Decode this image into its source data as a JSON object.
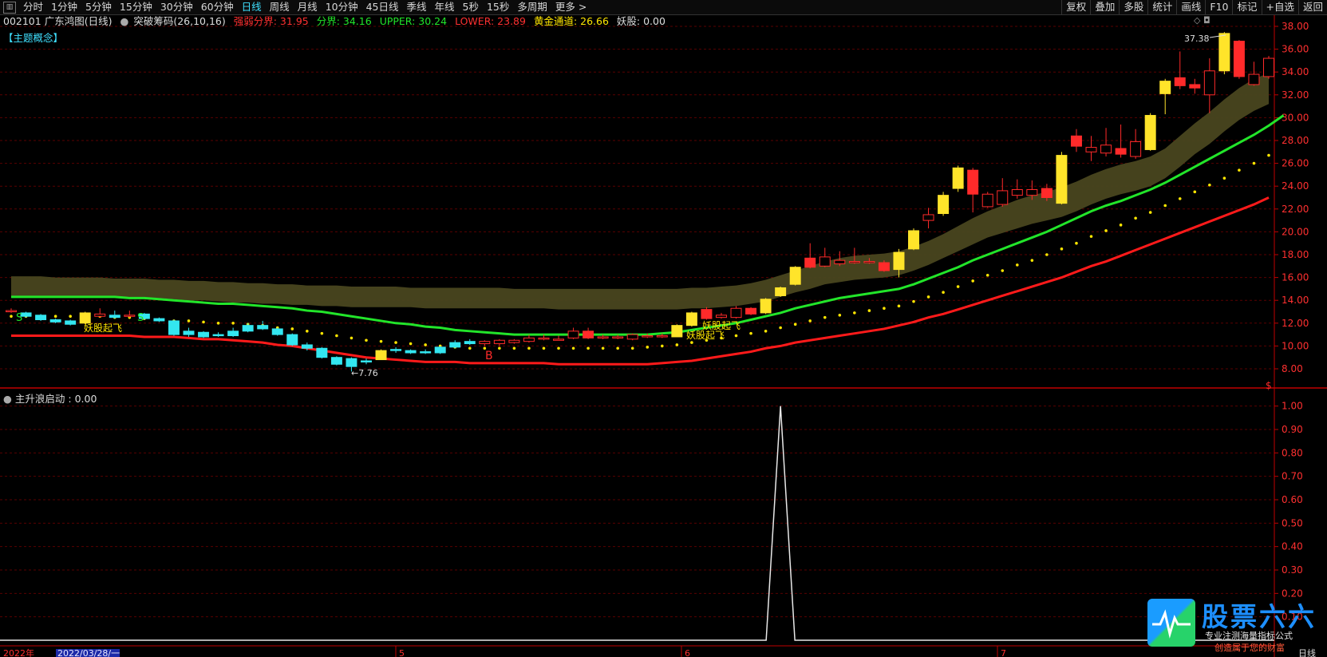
{
  "toolbar": {
    "menu_icon": "menu-icon",
    "periods": [
      "分时",
      "1分钟",
      "5分钟",
      "15分钟",
      "30分钟",
      "60分钟",
      "日线",
      "周线",
      "月线",
      "10分钟",
      "45日线",
      "季线",
      "年线",
      "5秒",
      "15秒",
      "多周期",
      "更多 >"
    ],
    "active_period": "日线",
    "right_buttons": [
      "复权",
      "叠加",
      "多股",
      "统计",
      "画线",
      "F10",
      "标记",
      "+自选",
      "返回"
    ]
  },
  "info": {
    "code_name": "002101 广东鸿图(日线)",
    "indicator": "突破筹码(26,10,16)",
    "qr_label": "强弱分界: 31.95",
    "fj_label": "分界: 34.16",
    "upper_label": "UPPER: 30.24",
    "lower_label": "LOWER: 23.89",
    "gold_label": "黄金通道: 26.66",
    "yao_label": "妖股: 0.00",
    "topic_tag": "【主题概念】",
    "icons": "◇ ◘"
  },
  "annotations": {
    "yao1": "妖股起飞",
    "yao2": "妖股起飞",
    "yao3": "妖股起飞",
    "low_label": "←7.76",
    "high_label": "37.38",
    "b_marker": "B",
    "s_marker1": "S",
    "s_marker2": "S",
    "s_marker3": "$"
  },
  "indicator_panel": {
    "title": "主升浪启动 : 0.00"
  },
  "axis": {
    "price_ticks": [
      "38.00",
      "36.00",
      "34.00",
      "32.00",
      "30.00",
      "28.00",
      "26.00",
      "24.00",
      "22.00",
      "20.00",
      "18.00",
      "16.00",
      "14.00",
      "12.00",
      "10.00",
      "8.00"
    ],
    "ind_ticks": [
      "1.00",
      "0.90",
      "0.80",
      "0.70",
      "0.60",
      "0.50",
      "0.40",
      "0.30",
      "0.20",
      "0.10"
    ],
    "dates": [
      "2022年",
      "2022/03/28/一",
      "5",
      "6",
      "7"
    ],
    "period_label": "日线"
  },
  "logo": {
    "title": "股票六六",
    "sub1": "专业注测海量指标公式",
    "sub2": "创造属于您的财富"
  },
  "colors": {
    "up": "#ff2a2a",
    "down": "#33e6f0",
    "yellow_candle": "#ffe42a",
    "green_line": "#22e52a",
    "red_line": "#ff1a1a",
    "band": "#49461f",
    "dots": "#ffe600",
    "grid": "#5a0000",
    "axis": "#c00000"
  },
  "chart_data": {
    "type": "candlestick",
    "price_range": [
      7,
      38.5
    ],
    "candles": [
      [
        13.1,
        13.0,
        13.3,
        12.9,
        "up"
      ],
      [
        12.9,
        12.6,
        13.0,
        12.5,
        "down"
      ],
      [
        12.7,
        12.3,
        12.8,
        12.2,
        "down"
      ],
      [
        12.3,
        12.1,
        12.4,
        12.0,
        "down"
      ],
      [
        12.2,
        11.9,
        12.3,
        11.8,
        "down"
      ],
      [
        12.0,
        12.9,
        13.0,
        11.9,
        "yellow"
      ],
      [
        12.8,
        12.6,
        13.3,
        12.5,
        "up"
      ],
      [
        12.7,
        12.5,
        13.1,
        12.4,
        "down"
      ],
      [
        12.6,
        12.7,
        13.1,
        12.5,
        "up"
      ],
      [
        12.8,
        12.4,
        12.9,
        12.3,
        "down"
      ],
      [
        12.4,
        12.2,
        12.5,
        12.1,
        "down"
      ],
      [
        12.2,
        11.0,
        12.3,
        10.9,
        "down"
      ],
      [
        11.0,
        11.3,
        11.6,
        10.8,
        "down"
      ],
      [
        11.2,
        10.8,
        11.3,
        10.7,
        "down"
      ],
      [
        11.0,
        11.0,
        11.2,
        10.8,
        "down"
      ],
      [
        10.9,
        11.3,
        11.6,
        10.8,
        "down"
      ],
      [
        11.3,
        11.8,
        12.0,
        11.2,
        "down"
      ],
      [
        11.8,
        11.5,
        12.2,
        11.4,
        "down"
      ],
      [
        11.5,
        11.0,
        11.6,
        10.9,
        "down"
      ],
      [
        11.0,
        10.1,
        11.1,
        10.0,
        "down"
      ],
      [
        10.1,
        9.8,
        10.3,
        9.6,
        "down"
      ],
      [
        9.8,
        9.0,
        9.9,
        8.9,
        "down"
      ],
      [
        9.0,
        8.4,
        9.1,
        8.3,
        "down"
      ],
      [
        8.2,
        8.9,
        9.0,
        7.76,
        "down"
      ],
      [
        8.7,
        8.6,
        8.9,
        8.4,
        "down"
      ],
      [
        8.8,
        9.6,
        9.7,
        8.8,
        "yellow"
      ],
      [
        9.6,
        9.7,
        9.9,
        9.4,
        "down"
      ],
      [
        9.6,
        9.4,
        9.7,
        9.3,
        "down"
      ],
      [
        9.5,
        9.4,
        9.7,
        9.3,
        "down"
      ],
      [
        9.4,
        9.9,
        10.0,
        9.3,
        "down"
      ],
      [
        9.9,
        10.3,
        10.5,
        9.8,
        "down"
      ],
      [
        10.2,
        10.4,
        10.6,
        10.1,
        "down"
      ],
      [
        10.4,
        10.2,
        10.5,
        10.0,
        "up"
      ],
      [
        10.2,
        10.5,
        10.6,
        10.0,
        "up"
      ],
      [
        10.5,
        10.3,
        10.6,
        10.2,
        "up"
      ],
      [
        10.4,
        10.7,
        11.0,
        10.3,
        "up"
      ],
      [
        10.7,
        10.6,
        11.0,
        10.5,
        "up"
      ],
      [
        10.6,
        10.6,
        10.9,
        10.5,
        "up"
      ],
      [
        10.7,
        11.3,
        11.6,
        10.6,
        "up"
      ],
      [
        11.3,
        10.7,
        11.6,
        10.6,
        "red"
      ],
      [
        10.8,
        10.8,
        11.0,
        10.6,
        "up"
      ],
      [
        10.8,
        10.7,
        11.0,
        10.6,
        "up"
      ],
      [
        10.6,
        11.0,
        11.1,
        10.5,
        "up"
      ],
      [
        10.9,
        10.9,
        11.1,
        10.7,
        "up"
      ],
      [
        10.9,
        10.8,
        11.1,
        10.7,
        "up"
      ],
      [
        10.8,
        11.8,
        11.9,
        10.8,
        "yellow"
      ],
      [
        11.8,
        12.9,
        13.0,
        11.7,
        "yellow"
      ],
      [
        13.2,
        12.4,
        13.4,
        12.3,
        "red"
      ],
      [
        12.5,
        12.7,
        12.9,
        12.4,
        "up"
      ],
      [
        12.5,
        13.3,
        13.5,
        12.4,
        "up"
      ],
      [
        13.3,
        12.8,
        13.4,
        12.7,
        "red"
      ],
      [
        12.9,
        14.1,
        14.2,
        12.8,
        "yellow"
      ],
      [
        14.4,
        15.1,
        15.2,
        14.3,
        "yellow"
      ],
      [
        15.4,
        16.9,
        17.0,
        15.3,
        "yellow"
      ],
      [
        17.7,
        16.9,
        19.0,
        16.8,
        "red"
      ],
      [
        17.0,
        17.8,
        18.6,
        16.9,
        "up"
      ],
      [
        17.5,
        17.2,
        18.3,
        17.0,
        "up"
      ],
      [
        17.3,
        17.4,
        18.6,
        17.2,
        "up"
      ],
      [
        17.3,
        17.4,
        17.7,
        17.2,
        "up"
      ],
      [
        17.3,
        16.6,
        17.5,
        16.5,
        "red"
      ],
      [
        16.7,
        18.2,
        18.5,
        16.0,
        "yellow"
      ],
      [
        18.5,
        20.1,
        20.3,
        18.4,
        "yellow"
      ],
      [
        21.0,
        21.5,
        22.1,
        20.3,
        "up"
      ],
      [
        21.6,
        23.2,
        23.5,
        21.4,
        "yellow"
      ],
      [
        23.8,
        25.6,
        25.8,
        23.5,
        "yellow"
      ],
      [
        25.4,
        23.3,
        25.6,
        21.7,
        "red"
      ],
      [
        23.3,
        22.2,
        23.5,
        22.1,
        "up"
      ],
      [
        22.4,
        23.6,
        24.7,
        22.2,
        "up"
      ],
      [
        23.7,
        23.2,
        24.6,
        22.9,
        "up"
      ],
      [
        23.2,
        23.7,
        24.5,
        22.8,
        "up"
      ],
      [
        23.8,
        23.0,
        24.2,
        22.7,
        "red"
      ],
      [
        22.5,
        26.7,
        27.0,
        22.4,
        "yellow"
      ],
      [
        28.4,
        27.5,
        29.0,
        27.0,
        "red"
      ],
      [
        27.0,
        27.4,
        28.4,
        26.2,
        "up"
      ],
      [
        27.6,
        26.9,
        29.1,
        26.6,
        "up"
      ],
      [
        27.3,
        26.8,
        29.4,
        26.5,
        "red"
      ],
      [
        26.6,
        27.9,
        29.0,
        26.4,
        "up"
      ],
      [
        27.2,
        30.2,
        30.4,
        27.1,
        "yellow"
      ],
      [
        33.2,
        32.1,
        33.4,
        30.3,
        "yellow"
      ],
      [
        33.5,
        32.8,
        35.8,
        32.5,
        "red"
      ],
      [
        32.9,
        32.6,
        33.4,
        32.1,
        "red"
      ],
      [
        32.0,
        34.1,
        35.2,
        30.4,
        "up"
      ],
      [
        37.38,
        34.1,
        37.5,
        33.8,
        "yellow"
      ],
      [
        36.7,
        33.6,
        36.8,
        33.4,
        "red"
      ],
      [
        32.9,
        33.8,
        34.9,
        32.8,
        "up"
      ],
      [
        33.6,
        35.2,
        35.4,
        33.4,
        "up"
      ]
    ],
    "upper_band": [
      16.1,
      16.1,
      16.1,
      16.0,
      16.0,
      16.0,
      16.0,
      15.9,
      15.9,
      15.9,
      15.8,
      15.8,
      15.7,
      15.7,
      15.6,
      15.6,
      15.5,
      15.5,
      15.4,
      15.4,
      15.3,
      15.3,
      15.3,
      15.2,
      15.2,
      15.2,
      15.2,
      15.1,
      15.1,
      15.1,
      15.1,
      15.1,
      15.1,
      15.1,
      15.0,
      15.0,
      15.0,
      15.0,
      15.0,
      15.0,
      15.0,
      15.0,
      15.0,
      15.0,
      15.0,
      15.0,
      15.1,
      15.1,
      15.2,
      15.3,
      15.5,
      15.8,
      16.2,
      16.6,
      17.0,
      17.4,
      17.7,
      17.9,
      18.0,
      18.1,
      18.3,
      18.7,
      19.2,
      19.8,
      20.5,
      21.2,
      21.8,
      22.3,
      22.8,
      23.2,
      23.5,
      23.9,
      24.4,
      25.0,
      25.5,
      25.9,
      26.2,
      26.6,
      27.3,
      28.4,
      29.5,
      30.5,
      31.6,
      32.6,
      33.4,
      33.9
    ],
    "lower_band": [
      14.4,
      14.4,
      14.4,
      14.4,
      14.4,
      14.4,
      14.3,
      14.3,
      14.3,
      14.2,
      14.2,
      14.1,
      14.0,
      14.0,
      13.9,
      13.8,
      13.8,
      13.7,
      13.7,
      13.6,
      13.6,
      13.5,
      13.5,
      13.4,
      13.4,
      13.4,
      13.4,
      13.4,
      13.3,
      13.3,
      13.3,
      13.3,
      13.3,
      13.3,
      13.3,
      13.3,
      13.3,
      13.2,
      13.2,
      13.2,
      13.2,
      13.2,
      13.2,
      13.2,
      13.2,
      13.2,
      13.3,
      13.3,
      13.4,
      13.5,
      13.7,
      13.9,
      14.3,
      14.7,
      15.0,
      15.4,
      15.6,
      15.8,
      15.9,
      16.0,
      16.2,
      16.6,
      17.1,
      17.7,
      18.3,
      18.9,
      19.5,
      19.9,
      20.3,
      20.7,
      21.0,
      21.3,
      21.8,
      22.4,
      22.9,
      23.3,
      23.6,
      24.0,
      24.7,
      25.7,
      26.8,
      27.7,
      28.8,
      29.8,
      30.6,
      31.2
    ],
    "green_line": [
      14.3,
      14.3,
      14.3,
      14.3,
      14.3,
      14.3,
      14.3,
      14.3,
      14.2,
      14.2,
      14.1,
      14.0,
      13.9,
      13.8,
      13.7,
      13.7,
      13.6,
      13.5,
      13.4,
      13.3,
      13.1,
      13.0,
      12.8,
      12.6,
      12.4,
      12.2,
      12.0,
      11.9,
      11.7,
      11.6,
      11.4,
      11.3,
      11.2,
      11.1,
      11.0,
      11.0,
      11.0,
      11.0,
      11.0,
      11.0,
      11.0,
      11.0,
      11.0,
      11.0,
      11.1,
      11.2,
      11.4,
      11.6,
      11.8,
      12.0,
      12.3,
      12.6,
      12.9,
      13.3,
      13.6,
      13.9,
      14.2,
      14.4,
      14.6,
      14.8,
      15.0,
      15.4,
      15.9,
      16.4,
      16.9,
      17.5,
      18.0,
      18.5,
      19.0,
      19.5,
      20.0,
      20.6,
      21.2,
      21.8,
      22.3,
      22.7,
      23.2,
      23.7,
      24.3,
      25.0,
      25.7,
      26.4,
      27.1,
      27.8,
      28.5,
      29.3,
      30.2
    ],
    "red_line": [
      10.9,
      10.9,
      10.9,
      10.9,
      10.9,
      10.9,
      10.9,
      10.9,
      10.9,
      10.8,
      10.8,
      10.8,
      10.7,
      10.6,
      10.6,
      10.5,
      10.4,
      10.3,
      10.1,
      10.0,
      9.8,
      9.6,
      9.4,
      9.2,
      9.0,
      8.9,
      8.8,
      8.7,
      8.6,
      8.6,
      8.6,
      8.5,
      8.5,
      8.5,
      8.5,
      8.5,
      8.5,
      8.4,
      8.4,
      8.4,
      8.4,
      8.4,
      8.4,
      8.4,
      8.5,
      8.6,
      8.7,
      8.9,
      9.1,
      9.3,
      9.5,
      9.8,
      10.0,
      10.3,
      10.5,
      10.7,
      10.9,
      11.1,
      11.3,
      11.5,
      11.8,
      12.1,
      12.5,
      12.8,
      13.2,
      13.6,
      14.0,
      14.4,
      14.8,
      15.2,
      15.6,
      16.0,
      16.5,
      17.0,
      17.4,
      17.9,
      18.4,
      18.9,
      19.4,
      19.9,
      20.4,
      20.9,
      21.4,
      21.9,
      22.4,
      23.0
    ],
    "dots": [
      12.6,
      12.6,
      12.6,
      12.6,
      12.6,
      12.6,
      12.6,
      12.5,
      12.5,
      12.4,
      12.3,
      12.2,
      12.2,
      12.1,
      12.0,
      12.0,
      11.9,
      11.8,
      11.6,
      11.5,
      11.3,
      11.1,
      10.9,
      10.7,
      10.5,
      10.4,
      10.3,
      10.2,
      10.1,
      10.0,
      9.9,
      9.8,
      9.8,
      9.8,
      9.8,
      9.8,
      9.8,
      9.8,
      9.8,
      9.8,
      9.8,
      9.8,
      9.8,
      9.9,
      10.0,
      10.1,
      10.3,
      10.5,
      10.7,
      10.9,
      11.1,
      11.3,
      11.6,
      11.9,
      12.2,
      12.5,
      12.7,
      12.9,
      13.1,
      13.3,
      13.5,
      13.9,
      14.3,
      14.7,
      15.2,
      15.7,
      16.2,
      16.6,
      17.1,
      17.5,
      18.0,
      18.5,
      19.0,
      19.6,
      20.1,
      20.6,
      21.2,
      21.7,
      22.3,
      22.9,
      23.5,
      24.1,
      24.7,
      25.4,
      26.0,
      26.7
    ],
    "indicator_values": {
      "peak_index": 52,
      "peak_value": 1.0,
      "range": [
        0,
        1.05
      ]
    }
  }
}
